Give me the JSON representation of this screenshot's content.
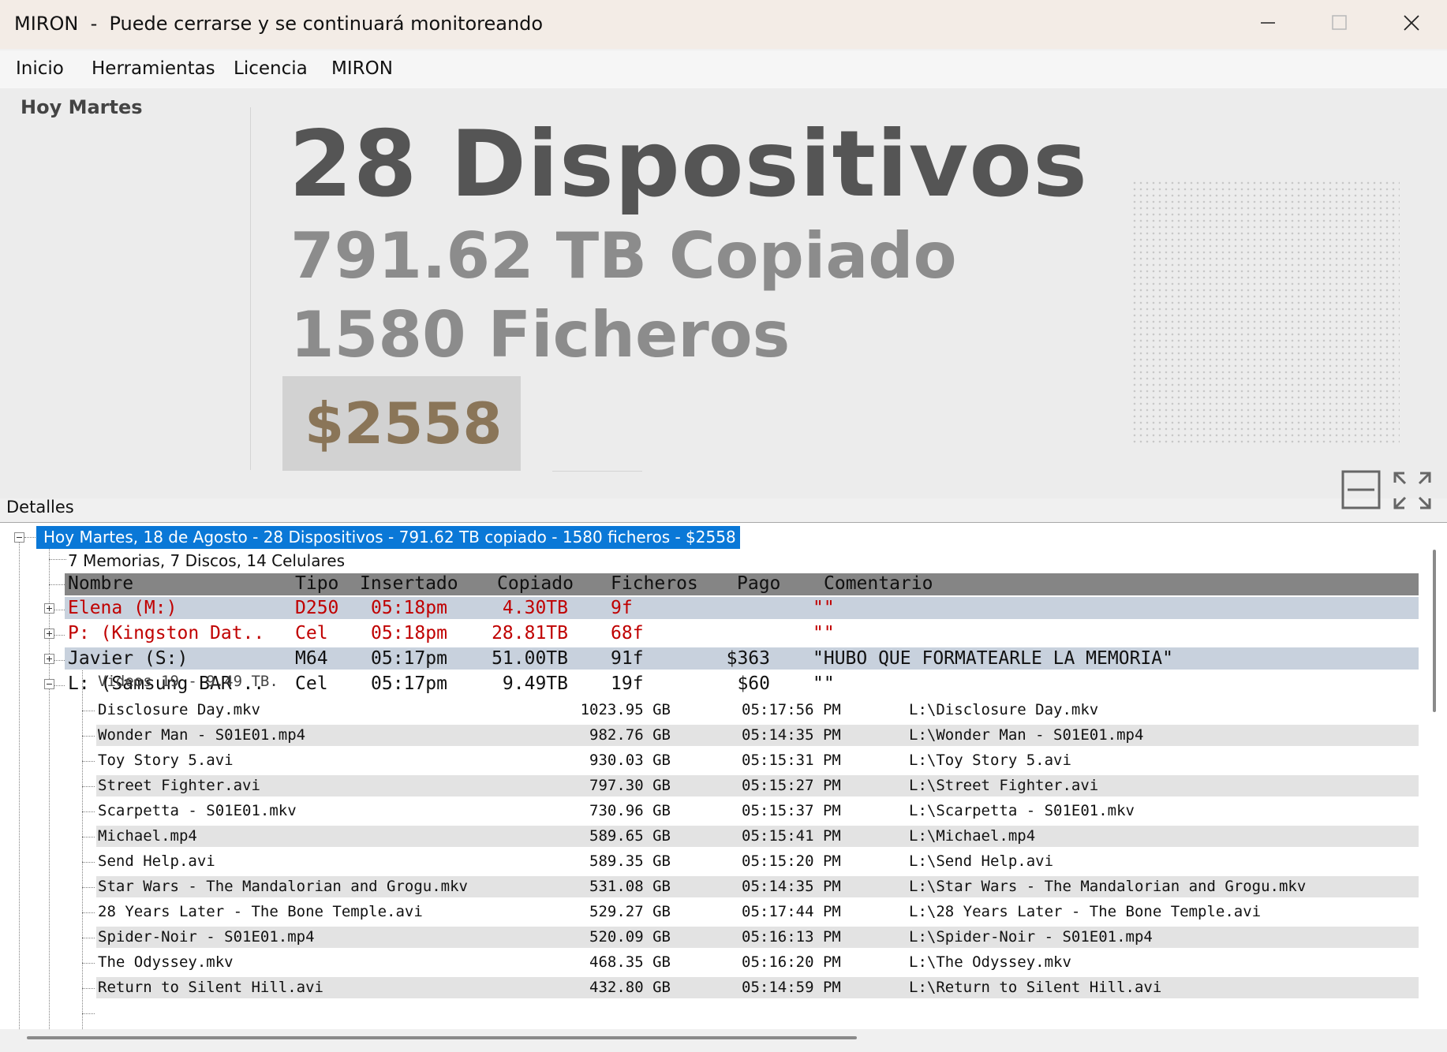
{
  "window": {
    "title": "MIRON  -  Puede cerrarse y se continuará monitoreando"
  },
  "menu": [
    "Inicio",
    "Herramientas",
    "Licencia",
    "MIRON"
  ],
  "dashboard": {
    "day_label": "Hoy Martes",
    "devices": "28  Dispositivos",
    "copied": "791.62 TB  Copiado",
    "files": "1580 Ficheros",
    "money": "$2558"
  },
  "details": {
    "label": "Detalles",
    "root": "Hoy Martes, 18 de Agosto  -  28 Dispositivos  -  791.62 TB copiado  -  1580 ficheros  -  $2558",
    "summary": "7 Memorias, 7 Discos, 14 Celulares",
    "columns": [
      "Nombre",
      "Tipo",
      "Insertado",
      "Copiado",
      "Ficheros",
      "Pago",
      "Comentario"
    ],
    "devices": [
      {
        "nombre": "Elena (M:)",
        "tipo": "D250",
        "insertado": "05:18pm",
        "copiado": "4.30TB",
        "ficheros": "9f",
        "pago": "",
        "comentario": "\"\"",
        "color": "#c00000",
        "expanded": false
      },
      {
        "nombre": "P: (Kingston Dat..",
        "tipo": "Cel",
        "insertado": "05:18pm",
        "copiado": "28.81TB",
        "ficheros": "68f",
        "pago": "",
        "comentario": "\"\"",
        "color": "#c00000",
        "expanded": false
      },
      {
        "nombre": "Javier (S:)",
        "tipo": "M64",
        "insertado": "05:17pm",
        "copiado": "51.00TB",
        "ficheros": "91f",
        "pago": "$363",
        "comentario": "\"HUBO QUE FORMATEARLE LA MEMORIA\"",
        "color": "#111111",
        "expanded": false
      },
      {
        "nombre": "L: (Samsung BAR ..",
        "tipo": "Cel",
        "insertado": "05:17pm",
        "copiado": "9.49TB",
        "ficheros": "19f",
        "pago": "$60",
        "comentario": "\"\"",
        "color": "#111111",
        "expanded": true
      }
    ],
    "videos_label": "Videos 19 - 9.49 TB.",
    "files": [
      {
        "name": "Disclosure Day.mkv",
        "size": "1023.95 GB",
        "time": "05:17:56 PM",
        "path": "L:\\Disclosure Day.mkv"
      },
      {
        "name": "Wonder Man - S01E01.mp4",
        "size": "982.76 GB",
        "time": "05:14:35 PM",
        "path": "L:\\Wonder Man - S01E01.mp4"
      },
      {
        "name": "Toy Story 5.avi",
        "size": "930.03 GB",
        "time": "05:15:31 PM",
        "path": "L:\\Toy Story 5.avi"
      },
      {
        "name": "Street Fighter.avi",
        "size": "797.30 GB",
        "time": "05:15:27 PM",
        "path": "L:\\Street Fighter.avi"
      },
      {
        "name": "Scarpetta - S01E01.mkv",
        "size": "730.96 GB",
        "time": "05:15:37 PM",
        "path": "L:\\Scarpetta - S01E01.mkv"
      },
      {
        "name": "Michael.mp4",
        "size": "589.65 GB",
        "time": "05:15:41 PM",
        "path": "L:\\Michael.mp4"
      },
      {
        "name": "Send Help.avi",
        "size": "589.35 GB",
        "time": "05:15:20 PM",
        "path": "L:\\Send Help.avi"
      },
      {
        "name": "Star Wars - The Mandalorian and Grogu.mkv",
        "size": "531.08 GB",
        "time": "05:14:35 PM",
        "path": "L:\\Star Wars - The Mandalorian and Grogu.mkv"
      },
      {
        "name": "28 Years Later - The Bone Temple.avi",
        "size": "529.27 GB",
        "time": "05:17:44 PM",
        "path": "L:\\28 Years Later - The Bone Temple.avi"
      },
      {
        "name": "Spider-Noir - S01E01.mp4",
        "size": "520.09 GB",
        "time": "05:16:13 PM",
        "path": "L:\\Spider-Noir - S01E01.mp4"
      },
      {
        "name": "The Odyssey.mkv",
        "size": "468.35 GB",
        "time": "05:16:20 PM",
        "path": "L:\\The Odyssey.mkv"
      },
      {
        "name": "Return to Silent Hill.avi",
        "size": "432.80 GB",
        "time": "05:14:59 PM",
        "path": "L:\\Return to Silent Hill.avi"
      }
    ]
  }
}
